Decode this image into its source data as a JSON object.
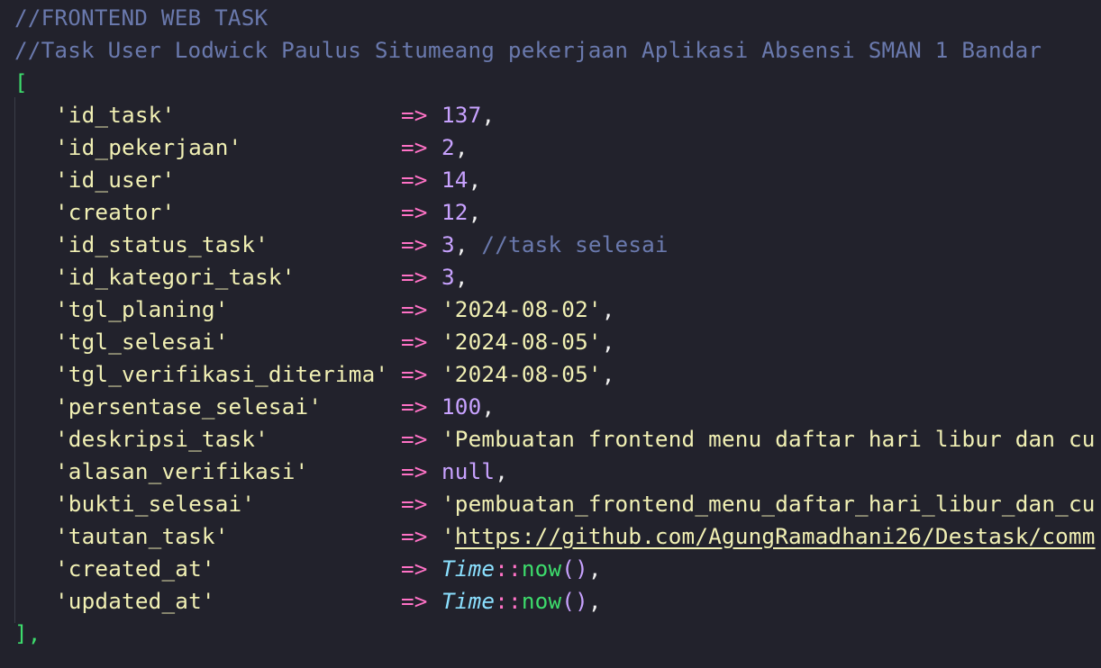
{
  "comments": [
    "//FRONTEND WEB TASK",
    "//Task User Lodwick Paulus Situmeang pekerjaan Aplikasi Absensi SMAN 1 Bandar"
  ],
  "open_bracket": "[",
  "close_bracket": "],",
  "arrow": "=>",
  "entries": [
    {
      "key": "'id_task'",
      "value": "137",
      "type": "number",
      "suffix": ","
    },
    {
      "key": "'id_pekerjaan'",
      "value": "2",
      "type": "number",
      "suffix": ","
    },
    {
      "key": "'id_user'",
      "value": "14",
      "type": "number",
      "suffix": ","
    },
    {
      "key": "'creator'",
      "value": "12",
      "type": "number",
      "suffix": ","
    },
    {
      "key": "'id_status_task'",
      "value": "3",
      "type": "number",
      "suffix": ",",
      "comment": " //task selesai"
    },
    {
      "key": "'id_kategori_task'",
      "value": "3",
      "type": "number",
      "suffix": ","
    },
    {
      "key": "'tgl_planing'",
      "value": "'2024-08-02'",
      "type": "string",
      "suffix": ","
    },
    {
      "key": "'tgl_selesai'",
      "value": "'2024-08-05'",
      "type": "string",
      "suffix": ","
    },
    {
      "key": "'tgl_verifikasi_diterima'",
      "value": "'2024-08-05'",
      "type": "string",
      "suffix": ","
    },
    {
      "key": "'persentase_selesai'",
      "value": "100",
      "type": "number",
      "suffix": ","
    },
    {
      "key": "'deskripsi_task'",
      "value": "'Pembuatan frontend menu daftar hari libur dan cu",
      "type": "string",
      "suffix": ""
    },
    {
      "key": "'alasan_verifikasi'",
      "value": "null",
      "type": "keyword",
      "suffix": ","
    },
    {
      "key": "'bukti_selesai'",
      "value": "'pembuatan_frontend_menu_daftar_hari_libur_dan_cu",
      "type": "string",
      "suffix": ""
    },
    {
      "key": "'tautan_task'",
      "value_quote": "'",
      "value": "https://github.com/AgungRamadhani26/Destask/comm",
      "type": "link",
      "suffix": ""
    },
    {
      "key": "'created_at'",
      "class_name": "Time",
      "sep": "::",
      "fn": "now",
      "parens": "()",
      "type": "call",
      "suffix": ","
    },
    {
      "key": "'updated_at'",
      "class_name": "Time",
      "sep": "::",
      "fn": "now",
      "parens": "()",
      "type": "call",
      "suffix": ","
    }
  ],
  "colors": {
    "background": "#22222c",
    "comment": "#6a79ad",
    "string": "#f1f0b4",
    "number": "#c8a2ff",
    "operator": "#ff72c6",
    "bracket": "#3ddc6c",
    "class": "#8be0ff"
  }
}
